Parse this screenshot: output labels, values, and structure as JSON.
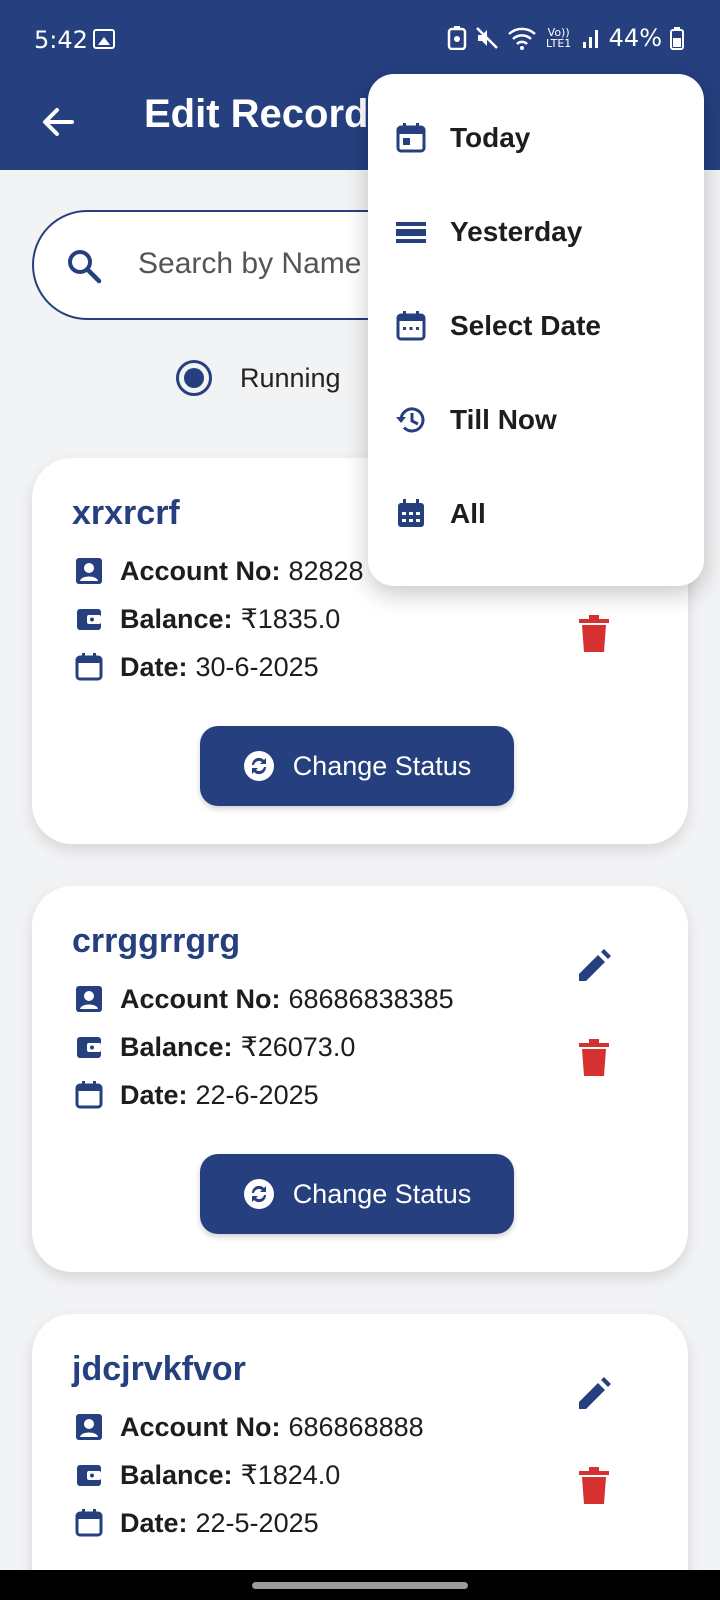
{
  "status_bar": {
    "time": "5:42",
    "network_label": "Vo)) LTE1",
    "battery": "44%"
  },
  "app_bar": {
    "title": "Edit Records"
  },
  "search": {
    "placeholder": "Search by Name"
  },
  "filter": {
    "running_label": "Running",
    "running_selected": true
  },
  "menu": {
    "items": [
      {
        "label": "Today",
        "icon": "calendar-today-icon"
      },
      {
        "label": "Yesterday",
        "icon": "lines-icon"
      },
      {
        "label": "Select Date",
        "icon": "calendar-dots-icon"
      },
      {
        "label": "Till Now",
        "icon": "history-icon"
      },
      {
        "label": "All",
        "icon": "calendar-grid-icon"
      }
    ]
  },
  "labels": {
    "account_no": "Account No:",
    "balance": "Balance:",
    "date": "Date:",
    "change_status": "Change Status"
  },
  "records": [
    {
      "name": "xrxrcrf",
      "account_no": "82828",
      "balance": "₹1835.0",
      "date": "30-6-2025"
    },
    {
      "name": "crrggrrgrg",
      "account_no": "68686838385",
      "balance": "₹26073.0",
      "date": "22-6-2025"
    },
    {
      "name": "jdcjrvkfvor",
      "account_no": "686868888",
      "balance": "₹1824.0",
      "date": "22-5-2025"
    }
  ],
  "colors": {
    "primary": "#253f7f",
    "delete": "#d63031",
    "background": "#f2f3f5"
  }
}
